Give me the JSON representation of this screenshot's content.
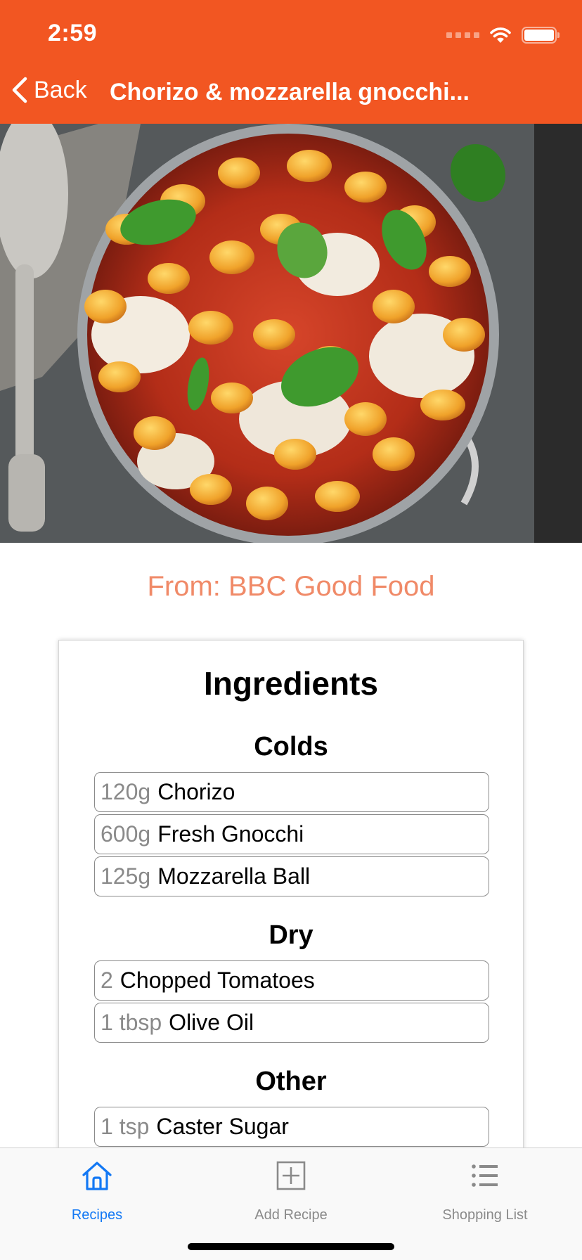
{
  "status_bar": {
    "time": "2:59"
  },
  "nav": {
    "back_label": "Back",
    "title": "Chorizo & mozzarella gnocchi..."
  },
  "recipe": {
    "image_alt": "Chorizo and mozzarella gnocchi bake in a pan",
    "source": "From: BBC Good Food"
  },
  "ingredients": {
    "title": "Ingredients",
    "groups": [
      {
        "name": "Colds",
        "items": [
          {
            "qty": "120g",
            "name": "Chorizo"
          },
          {
            "qty": "600g",
            "name": "Fresh Gnocchi"
          },
          {
            "qty": "125g",
            "name": "Mozzarella Ball"
          }
        ]
      },
      {
        "name": "Dry",
        "items": [
          {
            "qty": "2",
            "name": "Chopped Tomatoes"
          },
          {
            "qty": "1 tbsp",
            "name": "Olive Oil"
          }
        ]
      },
      {
        "name": "Other",
        "items": [
          {
            "qty": "1 tsp",
            "name": "Caster Sugar"
          }
        ]
      }
    ]
  },
  "tabbar": {
    "items": [
      {
        "label": "Recipes",
        "icon": "home-icon",
        "active": true
      },
      {
        "label": "Add Recipe",
        "icon": "plus-square-icon",
        "active": false
      },
      {
        "label": "Shopping List",
        "icon": "list-icon",
        "active": false
      }
    ]
  },
  "colors": {
    "brand": "#F25622",
    "source_text": "#F08A68",
    "tab_active": "#1378F4",
    "tab_inactive": "#8A8A8A"
  }
}
